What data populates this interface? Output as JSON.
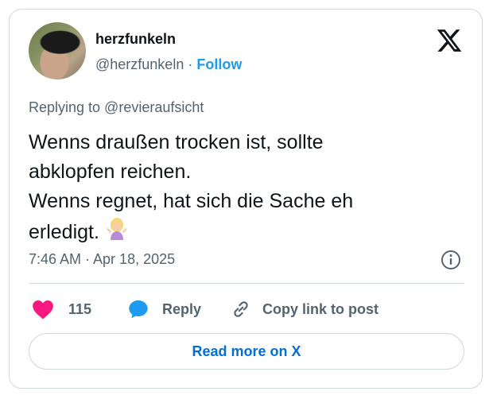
{
  "user": {
    "name": "herzfunkeln",
    "handle": "@herzfunkeln",
    "separator": "·",
    "follow_label": "Follow"
  },
  "tweet": {
    "replying_to": "Replying to @revieraufsicht",
    "lines": [
      "Wenns draußen trocken ist, sollte",
      "abklopfen reichen.",
      "Wenns regnet, hat sich die Sache eh",
      "erledigt."
    ],
    "emoji": "woman-shrugging-icon",
    "timestamp": "7:46 AM · Apr 18, 2025"
  },
  "actions": {
    "likes_count": "115",
    "reply_label": "Reply",
    "copy_label": "Copy link to post"
  },
  "read_more_label": "Read more on X",
  "colors": {
    "accent": "#1d9bf0",
    "like": "#f91880",
    "link": "#006fd6",
    "muted": "#536471",
    "border": "#cfd9de"
  }
}
